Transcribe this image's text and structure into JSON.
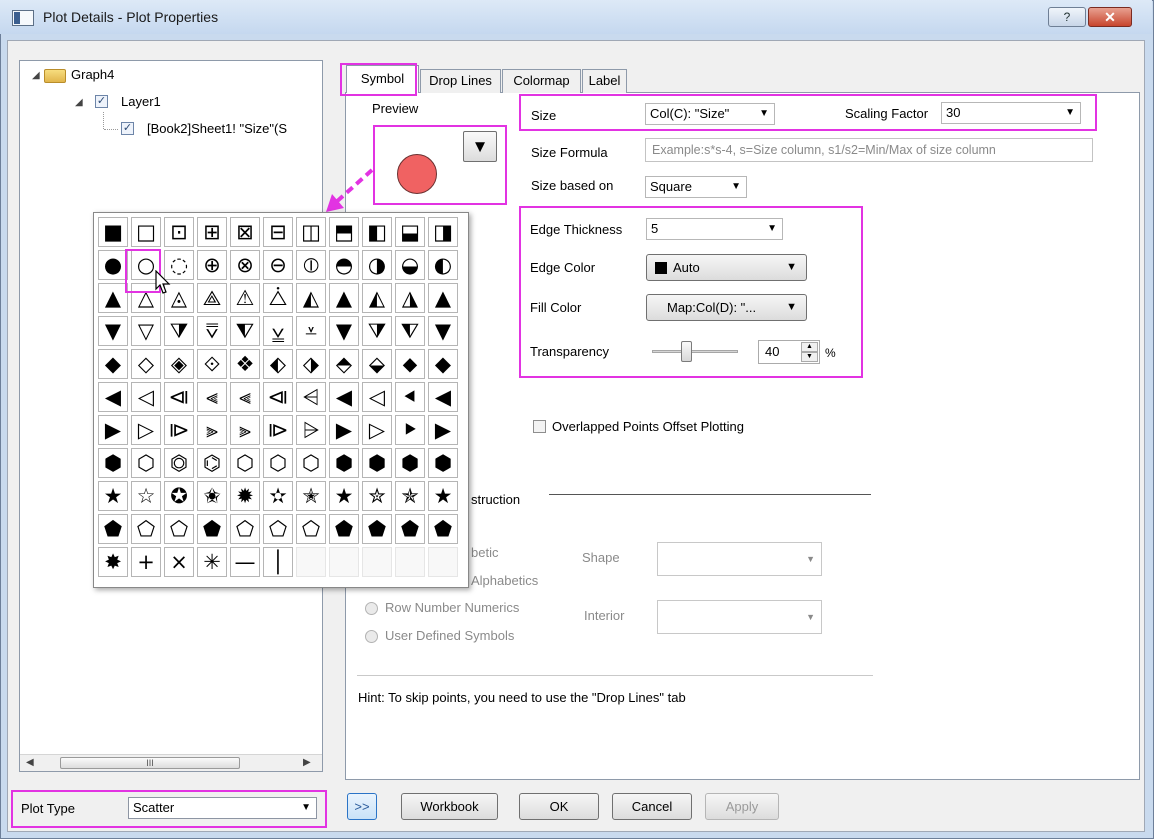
{
  "window": {
    "title": "Plot Details - Plot Properties",
    "help_label": "?",
    "close_label": "✕"
  },
  "tree": {
    "nodes": [
      {
        "label": "Graph4"
      },
      {
        "label": "Layer1"
      },
      {
        "label": "[Book2]Sheet1! \"Size\"(S"
      }
    ],
    "scroll_thumb": "III"
  },
  "plot_type": {
    "label": "Plot Type",
    "value": "Scatter"
  },
  "tabs": [
    "Symbol",
    "Drop Lines",
    "Colormap",
    "Label"
  ],
  "symbol": {
    "preview_label": "Preview",
    "preview_color": "#f06262",
    "size": {
      "label": "Size",
      "value": "Col(C): \"Size\""
    },
    "scaling": {
      "label": "Scaling Factor",
      "value": "30"
    },
    "size_formula": {
      "label": "Size Formula",
      "placeholder": "Example:s*s-4, s=Size column, s1/s2=Min/Max of size column"
    },
    "size_based_on": {
      "label": "Size based on",
      "value": "Square"
    },
    "edge_thickness": {
      "label": "Edge Thickness",
      "value": "5"
    },
    "edge_color": {
      "label": "Edge Color",
      "value": "Auto"
    },
    "fill_color": {
      "label": "Fill Color",
      "value": "Map:Col(D): \"..."
    },
    "transparency": {
      "label": "Transparency",
      "value": "40",
      "unit": "%",
      "fraction": 0.4
    },
    "overlap_label": "Overlapped Points Offset Plotting",
    "construction_label": "struction",
    "options": [
      "betic",
      "Alphabetics",
      "Row Number Numerics",
      "User Defined Symbols"
    ],
    "shape_label": "Shape",
    "interior_label": "Interior",
    "hint": "Hint: To skip points, you need to use the \"Drop Lines\" tab"
  },
  "buttons": {
    "expand": ">>",
    "workbook": "Workbook",
    "ok": "OK",
    "cancel": "Cancel",
    "apply": "Apply"
  },
  "palette": {
    "symbols": [
      [
        "■",
        "□",
        "⊡",
        "⊞",
        "⊠",
        "⊟",
        "◫",
        "⬒",
        "◧",
        "⬓",
        "◨"
      ],
      [
        "●",
        "○",
        "◌",
        "⊕",
        "⊗",
        "⊖",
        "⦶",
        "◓",
        "◑",
        "◒",
        "◐"
      ],
      [
        "▲",
        "△",
        "◬",
        "⟁",
        "⚠",
        "⧊",
        "◭",
        "▲",
        "◭",
        "◮",
        "▲"
      ],
      [
        "▼",
        "▽",
        "⧩",
        "⩢",
        "⧨",
        "⩣",
        "⩡",
        "▼",
        "⧩",
        "⧨",
        "▼"
      ],
      [
        "◆",
        "◇",
        "◈",
        "⟐",
        "❖",
        "⬖",
        "⬗",
        "⬘",
        "⬙",
        "⬥",
        "◆"
      ],
      [
        "◀",
        "◁",
        "⧏",
        "⫷",
        "⫷",
        "⧏",
        "⩤",
        "◀",
        "◁",
        "⯇",
        "◀"
      ],
      [
        "▶",
        "▷",
        "⧐",
        "⫸",
        "⫸",
        "⧐",
        "⩥",
        "▶",
        "▷",
        "⯈",
        "▶"
      ],
      [
        "⬢",
        "⬡",
        "⏣",
        "⌬",
        "⬡",
        "⬡",
        "⬡",
        "⬢",
        "⬢",
        "⬢",
        "⬢"
      ],
      [
        "★",
        "☆",
        "✪",
        "✬",
        "✹",
        "✫",
        "✭",
        "★",
        "✮",
        "✯",
        "★"
      ],
      [
        "⬟",
        "⬠",
        "⬠",
        "⬟",
        "⬠",
        "⬠",
        "⬠",
        "⬟",
        "⬟",
        "⬟",
        "⬟"
      ],
      [
        "✸",
        "+",
        "×",
        "✳",
        "—",
        "│",
        "",
        "",
        "",
        "",
        ""
      ]
    ]
  },
  "colors": {
    "highlight": "#e233e2"
  }
}
